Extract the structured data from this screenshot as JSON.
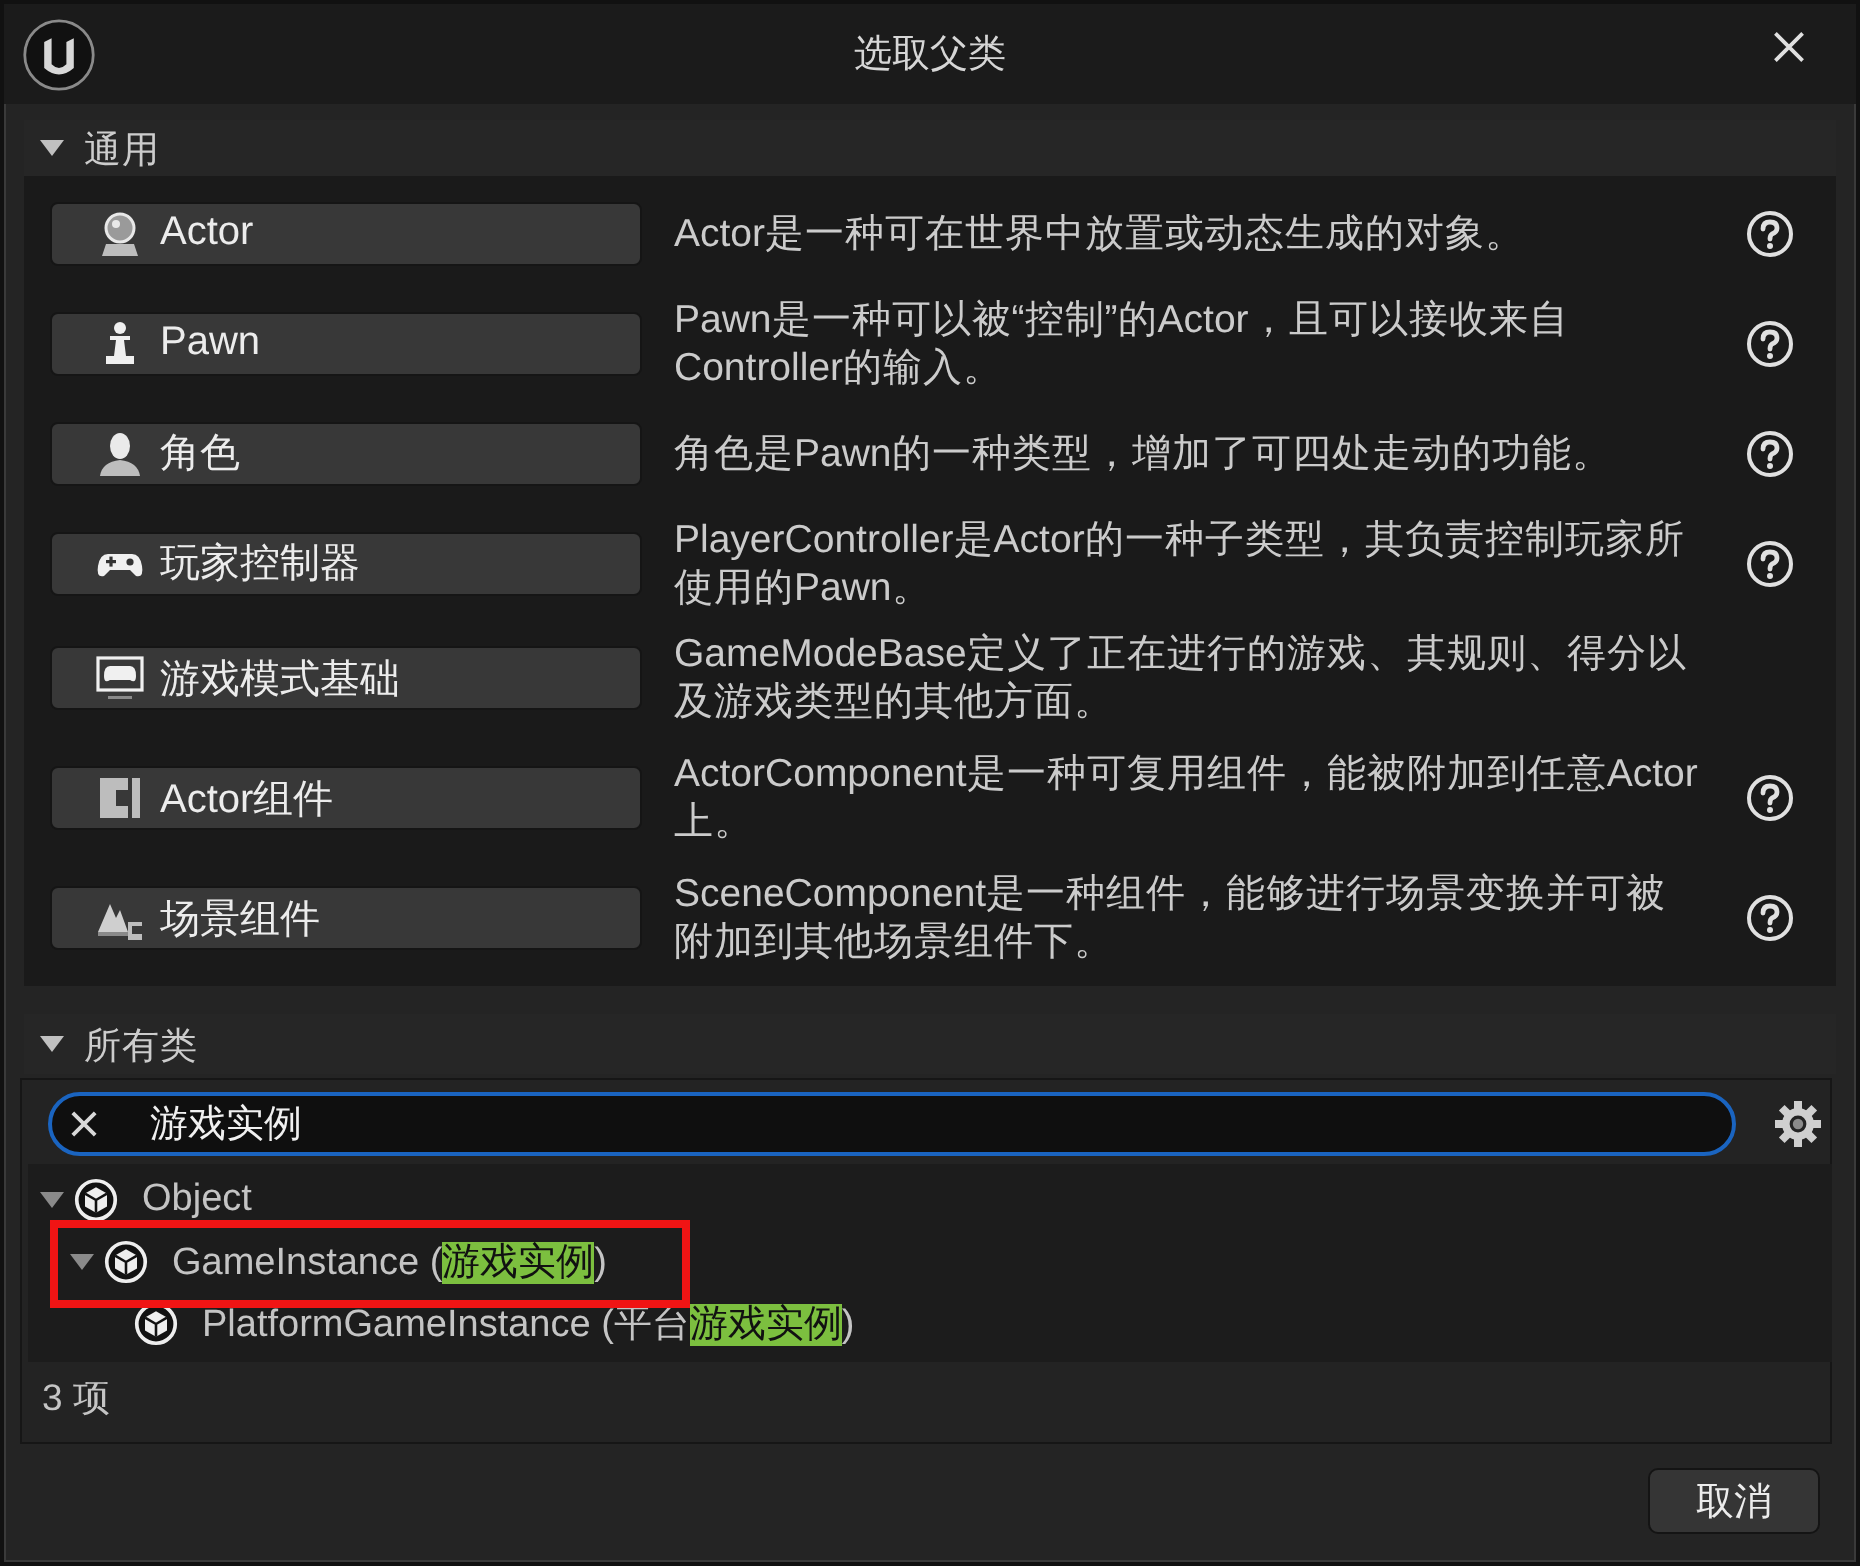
{
  "window": {
    "title": "选取父类"
  },
  "common_section": {
    "title": "通用",
    "expanded": true,
    "classes": [
      {
        "kind": "actor",
        "label": "Actor",
        "description": "Actor是一种可在世界中放置或动态生成的对象。",
        "help": true
      },
      {
        "kind": "pawn",
        "label": "Pawn",
        "description": "Pawn是一种可以被“控制”的Actor，且可以接收来自Controller的输入。",
        "help": true
      },
      {
        "kind": "character",
        "label": "角色",
        "description": "角色是Pawn的一种类型，增加了可四处走动的功能。",
        "help": true
      },
      {
        "kind": "controller",
        "label": "玩家控制器",
        "description": "PlayerController是Actor的一种子类型，其负责控制玩家所使用的Pawn。",
        "help": true
      },
      {
        "kind": "gamemode",
        "label": "游戏模式基础",
        "description": "GameModeBase定义了正在进行的游戏、其规则、得分以及游戏类型的其他方面。",
        "help": false
      },
      {
        "kind": "actor_component",
        "label": "Actor组件",
        "description": "ActorComponent是一种可复用组件，能被附加到任意Actor上。",
        "help": true
      },
      {
        "kind": "scene_component",
        "label": "场景组件",
        "description": "SceneComponent是一种组件，能够进行场景变换并可被附加到其他场景组件下。",
        "help": true
      }
    ]
  },
  "all_classes": {
    "title": "所有类",
    "expanded": true,
    "search": {
      "value": "游戏实例"
    },
    "tree": [
      {
        "parts": [
          {
            "text": "Object",
            "match": false
          }
        ],
        "expanded": true,
        "annotated": false,
        "children": [
          {
            "parts": [
              {
                "text": "GameInstance (",
                "match": false
              },
              {
                "text": "游戏实例",
                "match": true
              },
              {
                "text": ")",
                "match": false
              }
            ],
            "expanded": true,
            "annotated": true,
            "children": [
              {
                "parts": [
                  {
                    "text": "PlatformGameInstance (平台",
                    "match": false
                  },
                  {
                    "text": "游戏实例",
                    "match": true
                  },
                  {
                    "text": ")",
                    "match": false
                  }
                ],
                "annotated": false
              }
            ]
          }
        ]
      }
    ],
    "count": "3 项"
  },
  "buttons": [
    {
      "label": "取消"
    }
  ]
}
